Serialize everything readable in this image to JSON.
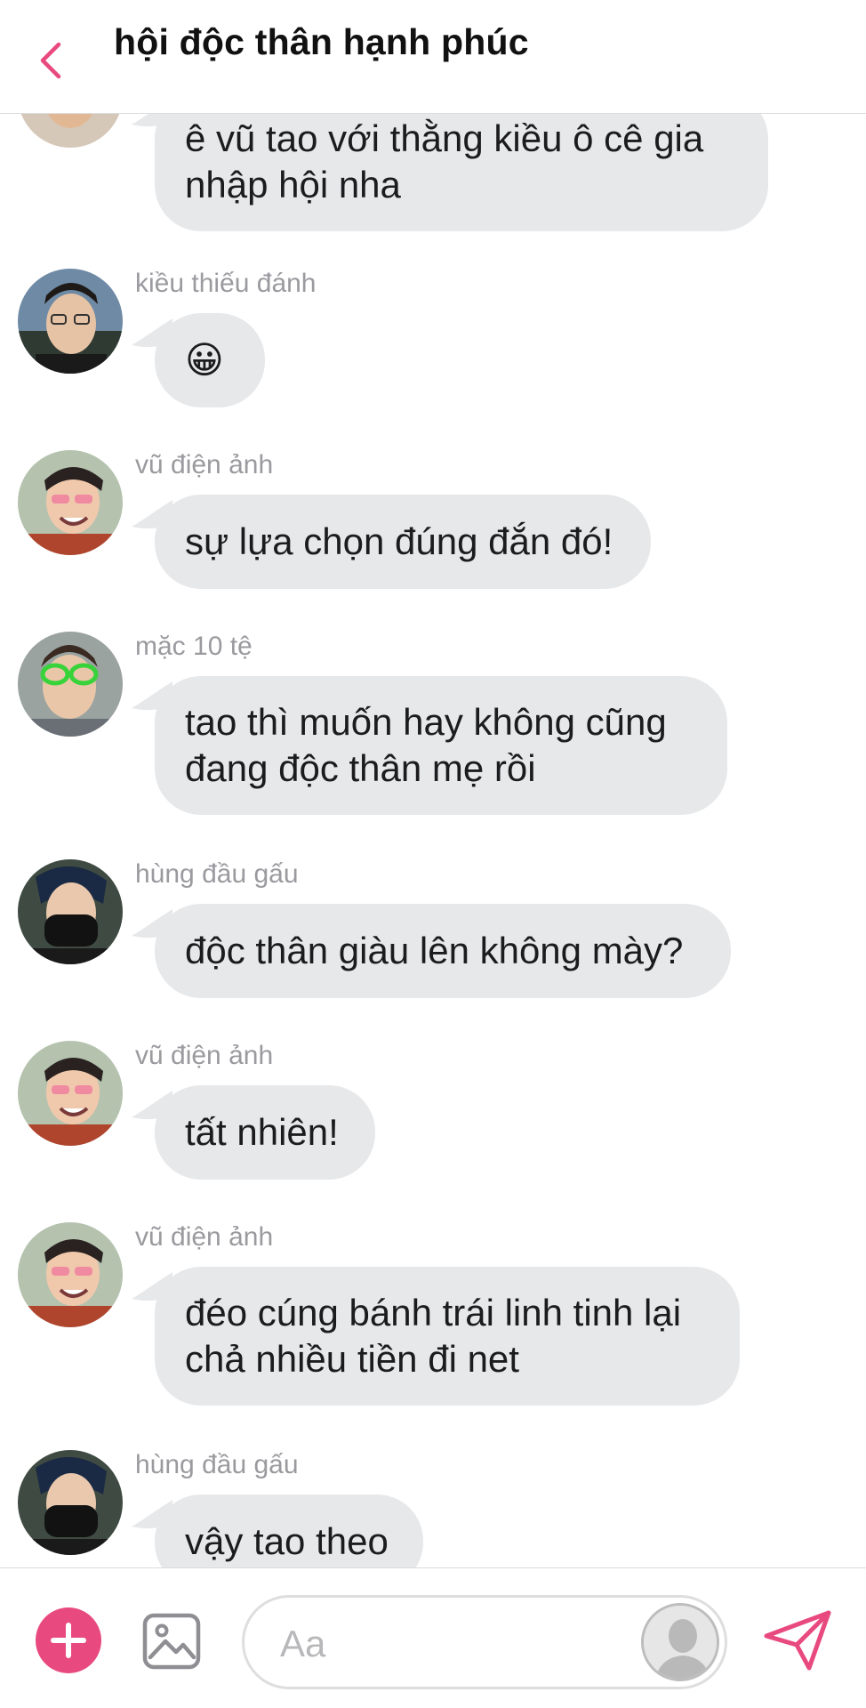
{
  "header": {
    "title": "hội độc thân hạnh phúc"
  },
  "messages": [
    {
      "sender": "",
      "text": "ê vũ tao với thằng kiều ô cê gia\nnhập hội nha",
      "avatar": "avatar-top-partial"
    },
    {
      "sender": "kiều thiếu đánh",
      "text": "😀",
      "avatar": "kieu-thieu-danh-avatar"
    },
    {
      "sender": "vũ điện ảnh",
      "text": "sự lựa chọn đúng đắn đó!",
      "avatar": "vu-dien-anh-avatar"
    },
    {
      "sender": "mặc 10 tệ",
      "text": "tao thì muốn hay không cũng\nđang độc thân mẹ rồi",
      "avatar": "mac-10-te-avatar"
    },
    {
      "sender": "hùng đầu gấu",
      "text": "độc thân giàu lên không mày?",
      "avatar": "hung-dau-gau-avatar"
    },
    {
      "sender": "vũ điện ảnh",
      "text": "tất nhiên!",
      "avatar": "vu-dien-anh-avatar"
    },
    {
      "sender": "vũ điện ảnh",
      "text": "đéo cúng bánh trái linh tinh lại\nchả nhiều tiền đi net",
      "avatar": "vu-dien-anh-avatar"
    },
    {
      "sender": "hùng đầu gấu",
      "text": "vậy tao theo",
      "avatar": "hung-dau-gau-avatar"
    }
  ],
  "composer": {
    "placeholder": "Aa"
  },
  "colors": {
    "accent": "#e84a7f",
    "bubble": "#e7e8ea",
    "sender_text": "#9a9a9f"
  },
  "icons": {
    "back": "chevron-left-icon",
    "add": "plus-icon",
    "image": "image-icon",
    "send": "paper-plane-icon"
  }
}
